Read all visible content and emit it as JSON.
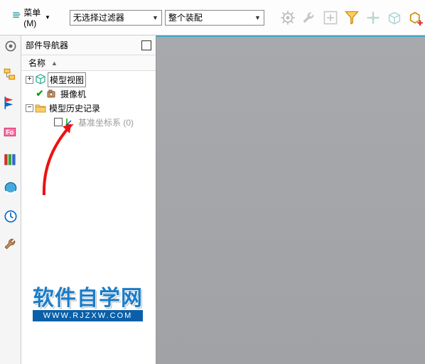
{
  "toolbar": {
    "menu_label": "菜单(M)",
    "filter_dropdown": "无选择过滤器",
    "assembly_dropdown": "整个装配"
  },
  "navigator": {
    "title": "部件导航器",
    "column_header": "名称"
  },
  "tree": {
    "model_view": "模型视图",
    "camera": "摄像机",
    "history": "模型历史记录",
    "csys": "基准坐标系 (0)"
  },
  "watermark": {
    "main": "软件自学网",
    "sub": "WWW.RJZXW.COM"
  }
}
